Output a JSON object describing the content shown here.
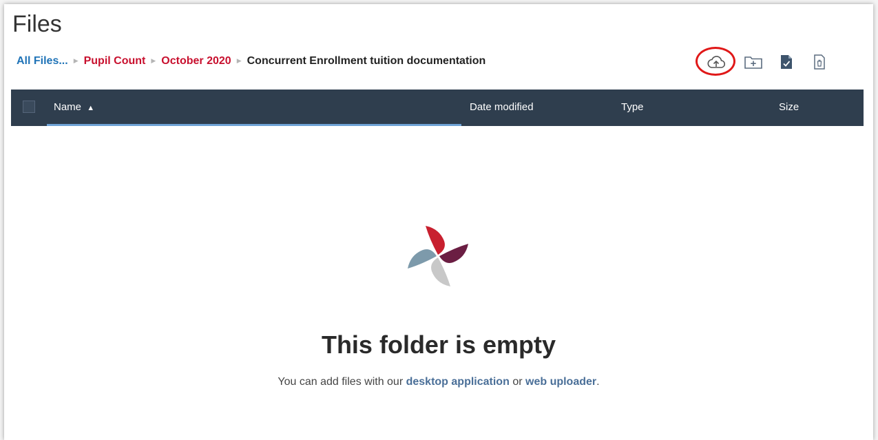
{
  "page": {
    "title": "Files"
  },
  "breadcrumb": {
    "root": "All Files...",
    "items": [
      "Pupil Count",
      "October 2020"
    ],
    "current": "Concurrent Enrollment tuition documentation",
    "separator": "▶"
  },
  "toolbar": {
    "icons": [
      "cloud-upload-icon",
      "new-folder-icon",
      "request-file-icon",
      "trash-icon"
    ]
  },
  "table": {
    "columns": {
      "name": "Name",
      "date": "Date modified",
      "type": "Type",
      "size": "Size"
    },
    "sort_indicator": "▲"
  },
  "empty_state": {
    "title": "This folder is empty",
    "text_before": "You can add files with our",
    "link_desktop": "desktop application",
    "text_middle": "or",
    "link_web": "web uploader",
    "text_after": "."
  },
  "colors": {
    "header_bg": "#2f3e4e",
    "crumb_root": "#1f73b7",
    "crumb_link": "#c8102e",
    "highlight": "#e01818",
    "logo_red": "#c8202f",
    "logo_plum": "#6b1e43",
    "logo_gray": "#c8c8c8",
    "logo_blue": "#7d9aab"
  }
}
